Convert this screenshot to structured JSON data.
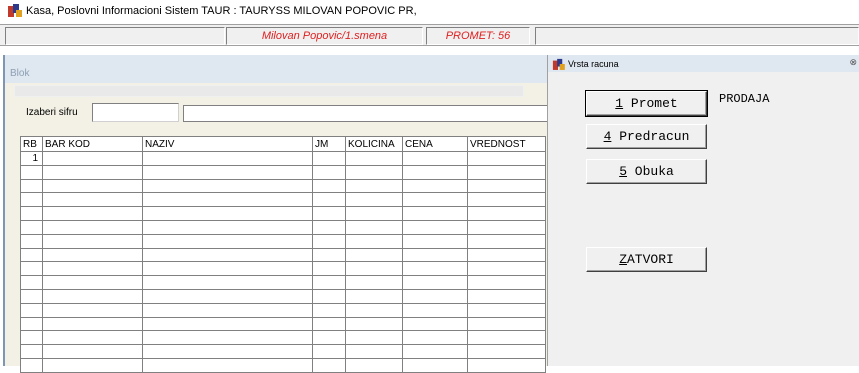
{
  "window": {
    "title": "Kasa, Poslovni Informacioni Sistem TAUR : TAURYSS MILOVAN POPOVIC PR,",
    "icon": "app-logo-icon"
  },
  "status": {
    "cashier": "Milovan Popovic/1.smena",
    "promet": "PROMET: 56"
  },
  "blok": {
    "label": "Blok",
    "sifra_label": "Izaberi sifru",
    "sifra_value": "",
    "sifra_desc": ""
  },
  "table": {
    "columns": [
      "RB",
      "BAR KOD",
      "NAZIV",
      "JM",
      "KOLICINA",
      "CENA",
      "VREDNOST"
    ],
    "rows": [
      [
        "1",
        "",
        "",
        "",
        "",
        "",
        ""
      ]
    ]
  },
  "dialog": {
    "title": "Vrsta racuna",
    "close": "⊗",
    "mode": "PRODAJA",
    "buttons": [
      {
        "key": "1",
        "rest": " Promet"
      },
      {
        "key": "4",
        "rest": " Predracun"
      },
      {
        "key": "5",
        "rest": " Obuka"
      },
      {
        "key": "Z",
        "rest": "ATVORI"
      }
    ]
  },
  "colors": {
    "status_text": "#e02020",
    "panel_header": "#dfe7f0",
    "panel_bg": "#f3f1e6"
  }
}
